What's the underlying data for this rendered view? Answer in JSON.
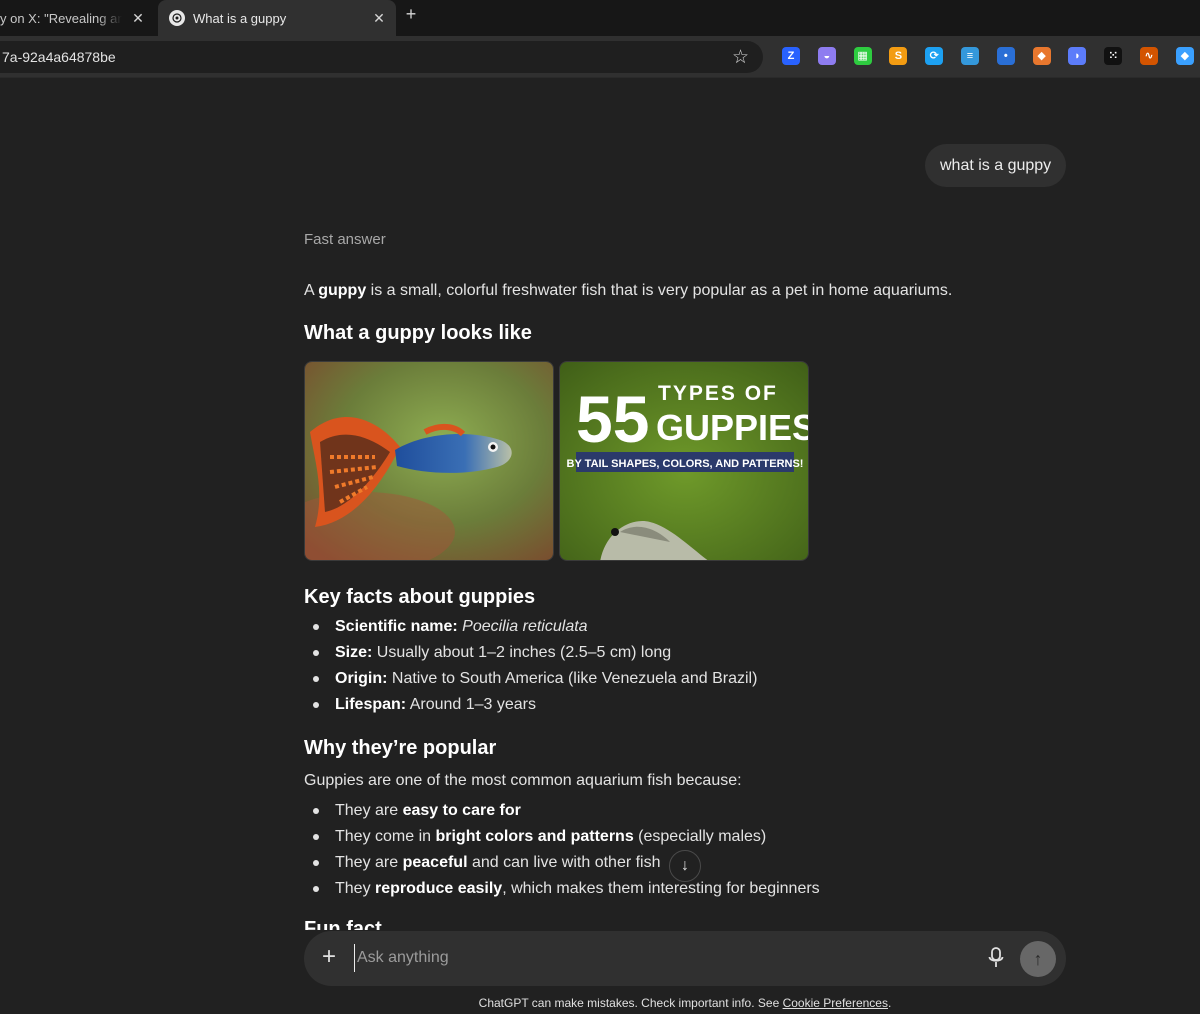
{
  "browser": {
    "tabs": [
      {
        "title": "y on X: \"Revealing anoth"
      },
      {
        "title": "What is a guppy"
      }
    ],
    "url_fragment": "7a-92a4a64878be",
    "extensions": [
      {
        "icon": "z-extension-icon",
        "color": "#2962ff",
        "glyph": "Z"
      },
      {
        "icon": "ghost-extension-icon",
        "color": "#8e7cf0",
        "glyph": "◒"
      },
      {
        "icon": "grid-extension-icon",
        "color": "#2ecc40",
        "glyph": "▦"
      },
      {
        "icon": "s-extension-icon",
        "color": "#f39c12",
        "glyph": "S"
      },
      {
        "icon": "refresh-extension-icon",
        "color": "#1da1f2",
        "glyph": "⟳"
      },
      {
        "icon": "list-extension-icon",
        "color": "#3498db",
        "glyph": "≡"
      },
      {
        "icon": "dot-extension-icon",
        "color": "#2a6fd6",
        "glyph": "•"
      },
      {
        "icon": "fox-extension-icon",
        "color": "#e8772e",
        "glyph": "◆"
      },
      {
        "icon": "bird-extension-icon",
        "color": "#5c7cfa",
        "glyph": "◗"
      },
      {
        "icon": "dots-extension-icon",
        "color": "#111111",
        "glyph": "⁙"
      },
      {
        "icon": "sign-extension-icon",
        "color": "#d35400",
        "glyph": "∿"
      },
      {
        "icon": "diamond-extension-icon",
        "color": "#3aa0ff",
        "glyph": "◆"
      }
    ]
  },
  "chat": {
    "user_message": "what is a guppy",
    "meta_label": "Fast answer",
    "intro": {
      "pre": "A ",
      "bold": "guppy",
      "post": " is a small, colorful freshwater fish that is very popular as a pet in home aquariums."
    },
    "heading_looks": "What a guppy looks like",
    "image2": {
      "big": "55",
      "line1": "TYPES OF",
      "line2": "GUPPIES",
      "banner": "BY TAIL SHAPES, COLORS, AND PATTERNS!"
    },
    "heading_facts": "Key facts about guppies",
    "facts": [
      {
        "label": "Scientific name:",
        "value": "Poecilia reticulata"
      },
      {
        "label": "Size:",
        "value": " Usually about 1–2 inches (2.5–5 cm) long"
      },
      {
        "label": "Origin:",
        "value": " Native to South America (like Venezuela and Brazil)"
      },
      {
        "label": "Lifespan:",
        "value": " Around 1–3 years"
      }
    ],
    "heading_popular": "Why they’re popular",
    "popular_intro": "Guppies are one of the most common aquarium fish because:",
    "reasons": [
      {
        "pre": "They are ",
        "bold": "easy to care for",
        "post": ""
      },
      {
        "pre": "They come in ",
        "bold": "bright colors and patterns",
        "post": " (especially males)"
      },
      {
        "pre": "They are ",
        "bold": "peaceful",
        "post": " and can live with other fish"
      },
      {
        "pre": "They ",
        "bold": "reproduce easily",
        "post": ", which makes them interesting for beginners"
      }
    ],
    "heading_fun": "Fun fact"
  },
  "composer": {
    "placeholder": "Ask anything"
  },
  "footer": {
    "text": "ChatGPT can make mistakes. Check important info. See ",
    "link": "Cookie Preferences",
    "end": "."
  }
}
